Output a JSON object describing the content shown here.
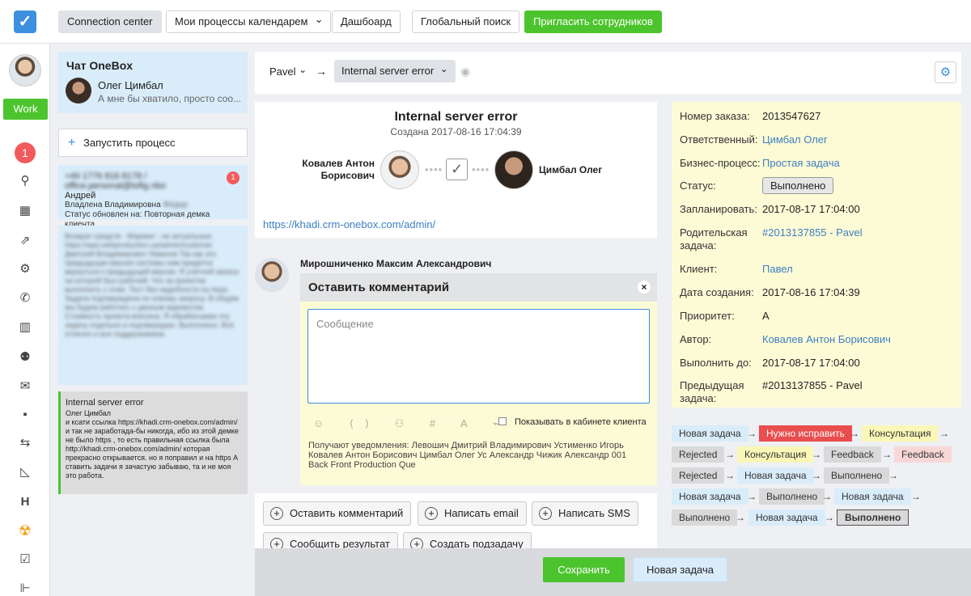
{
  "topbar": {
    "logo_glyph": "✓",
    "buttons": [
      "Connection center",
      "Мои процессы календарем",
      "Дашбоард",
      "Глобальный поиск",
      "Пригласить сотрудников"
    ],
    "dropdown_chevron": "⌄"
  },
  "leftnav": {
    "work_label": "Work",
    "notification_count": "1",
    "icons": [
      "search-icon",
      "calendar-icon",
      "chart-icon",
      "gear-icon",
      "phone-icon",
      "barcode-icon",
      "add-user-icon",
      "mail-icon",
      "folder-icon",
      "transfer-icon",
      "ruler-icon",
      "h-icon",
      "radiation-icon",
      "checkbox-icon",
      "timeline-icon"
    ],
    "glyphs": {
      "search": "⚲",
      "calendar": "▦",
      "chart": "⇗",
      "gear": "⚙",
      "phone": "✆",
      "barcode": "▥",
      "adduser": "⚉",
      "mail": "✉",
      "folder": "▪",
      "transfer": "⇆",
      "ruler": "◺",
      "h": "H",
      "radiation": "☢",
      "checkbox": "☑",
      "timeline": "⊩"
    }
  },
  "chat": {
    "title": "Чат OneBox",
    "contact_name": "Олег Цимбал",
    "last_message": "А мне бы хватило, просто соо...",
    "start_process": "Запустить процесс",
    "card1": {
      "phone": "+49 1776 816 8178 / office.personal@tofig.nbo",
      "name": "Андрей",
      "sub": "Владлена Владимировна",
      "sub_blur": "Фёдор",
      "status": "Статус обновлен на: Повторная демка клиента",
      "badge": "1"
    },
    "card2_blurred": "Возврат средств - Маркинг - не актуальные https://aaa-webproduction.ua/admin/customer Дмитрий Владимирович Ливанов Так как это предыдущая версия системы нам придется вернуться к предыдущей версии. Я учётной записи на которой был рабочий. Что за проектов выполнить с этим. Тест без надобности на пере. Задача подтверждена по новому запросу. В общем мы будем работать с данным вариантом. Стоимость проекта внесена. Я обрабатываю эту задачу отдельно и подтверждаю. Выполнено. Всё отлично и все поддерживаем.",
    "card3": {
      "title": "Internal server error",
      "author": "Олег Цимбал",
      "body": "и ксати ссылка https://khadi.crm-onebox.com/admin/ и так не заработада-бы никогда, ибо из этой демке не было https , то есть правильная ссылка была http://khadi.crm-onebox.com/admin/ которая прекрасно открывается. но я поправил и на https А ставить задачи я зачастую забываю, та и не моя это работа."
    }
  },
  "breadcrumb": {
    "user": "Pavel",
    "arrow": "→",
    "task": "Internal server error",
    "chevron": "⌄",
    "eye": "◉"
  },
  "task": {
    "title": "Internal server error",
    "created": "Создана 2017-08-16 17:04:39",
    "from": "Ковалев Антон Борисович",
    "to": "Цимбал Олег",
    "check": "✓",
    "link": "https://khadi.crm-onebox.com/admin/"
  },
  "comment": {
    "author": "Мирошниченко Максим Александрович",
    "header": "Оставить комментарий",
    "close": "×",
    "placeholder": "Сообщение",
    "toolbar_icons": "☺ ⟨⟩ ⚇ # A ⌁",
    "show_in_cabinet": "Показывать в кабинете клиента",
    "notify": "Получают уведомления: Левошич Дмитрий Владимирович Устименко Игорь Ковалев Антон Борисович Цимбал Олег Ус Александр Чижик Александр 001 Back Front Production Que"
  },
  "actions": [
    "Оставить комментарий",
    "Написать email",
    "Написать SMS",
    "Сообщить результат",
    "Создать подзадачу"
  ],
  "action_plus": "+",
  "footer": {
    "save": "Сохранить",
    "new_task": "Новая задача"
  },
  "properties": [
    {
      "label": "Номер заказа:",
      "value": "2013547627",
      "link": false
    },
    {
      "label": "Ответственный:",
      "value": "Цимбал Олег",
      "link": true
    },
    {
      "label": "Бизнес-процесс:",
      "value": "Простая задача",
      "link": true
    },
    {
      "label": "Статус:",
      "value": "Выполнено",
      "link": false
    },
    {
      "label": "Запланировать:",
      "value": "2017-08-17 17:04:00",
      "link": false
    },
    {
      "label": "Родительская задача:",
      "value": "#2013137855 - Pavel",
      "link": true
    },
    {
      "label": "Клиент:",
      "value": "Павел",
      "link": true
    },
    {
      "label": "Дата создания:",
      "value": "2017-08-16 17:04:39",
      "link": false
    },
    {
      "label": "Приоритет:",
      "value": "A",
      "link": false
    },
    {
      "label": "Автор:",
      "value": "Ковалев Антон Борисович",
      "link": true
    },
    {
      "label": "Выполнить до:",
      "value": "2017-08-17 17:04:00",
      "link": false
    },
    {
      "label": "Предыдущая задача:",
      "value": "#2013137855 - Pavel",
      "link": false
    }
  ],
  "flow": [
    [
      "Новая задача",
      "Нужно исправить",
      "Консультация"
    ],
    [
      "Rejected",
      "Консультация",
      "Feedback",
      "Feedback"
    ],
    [
      "Rejected",
      "Новая задача",
      "Выполнено"
    ],
    [
      "Новая задача",
      "Выполнено",
      "Новая задача"
    ],
    [
      "Выполнено",
      "Новая задача",
      "Выполнено"
    ]
  ],
  "flow_arrow": "→"
}
